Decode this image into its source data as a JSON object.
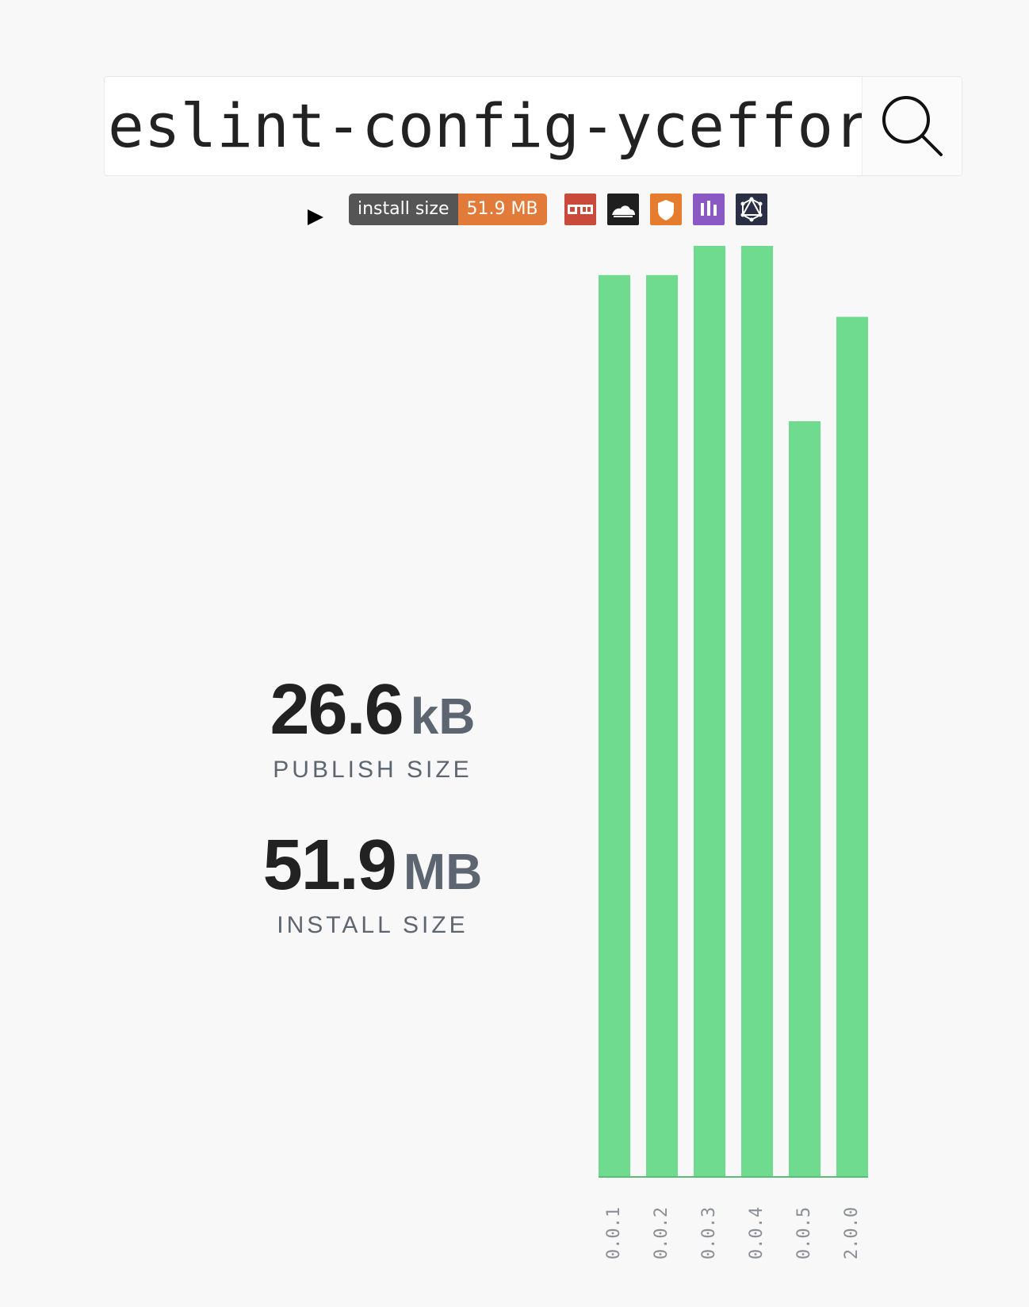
{
  "search": {
    "value": "eslint-config-yceffor",
    "placeholder": ""
  },
  "badges": {
    "install_label": "install size",
    "install_value": "51.9 MB",
    "icons": [
      "npm-icon",
      "cloudflare-icon",
      "snyk-icon",
      "bundle-icon",
      "graphql-icon"
    ]
  },
  "stats": {
    "publish": {
      "value": "26.6",
      "unit": "kB",
      "label": "PUBLISH SIZE"
    },
    "install": {
      "value": "51.9",
      "unit": "MB",
      "label": "INSTALL SIZE"
    }
  },
  "colors": {
    "bar": "#6fdb8f",
    "badge_orange": "#e27b3a",
    "badge_gray": "#555555",
    "background": "#f8f8f8"
  },
  "chart_data": {
    "type": "bar",
    "categories": [
      "0.0.1",
      "0.0.2",
      "0.0.3",
      "0.0.4",
      "0.0.5",
      "2.0.0"
    ],
    "values": [
      1080,
      1080,
      1115,
      1115,
      905,
      1030
    ],
    "title": "",
    "xlabel": "",
    "ylabel": "",
    "ylim": [
      0,
      1115
    ]
  }
}
